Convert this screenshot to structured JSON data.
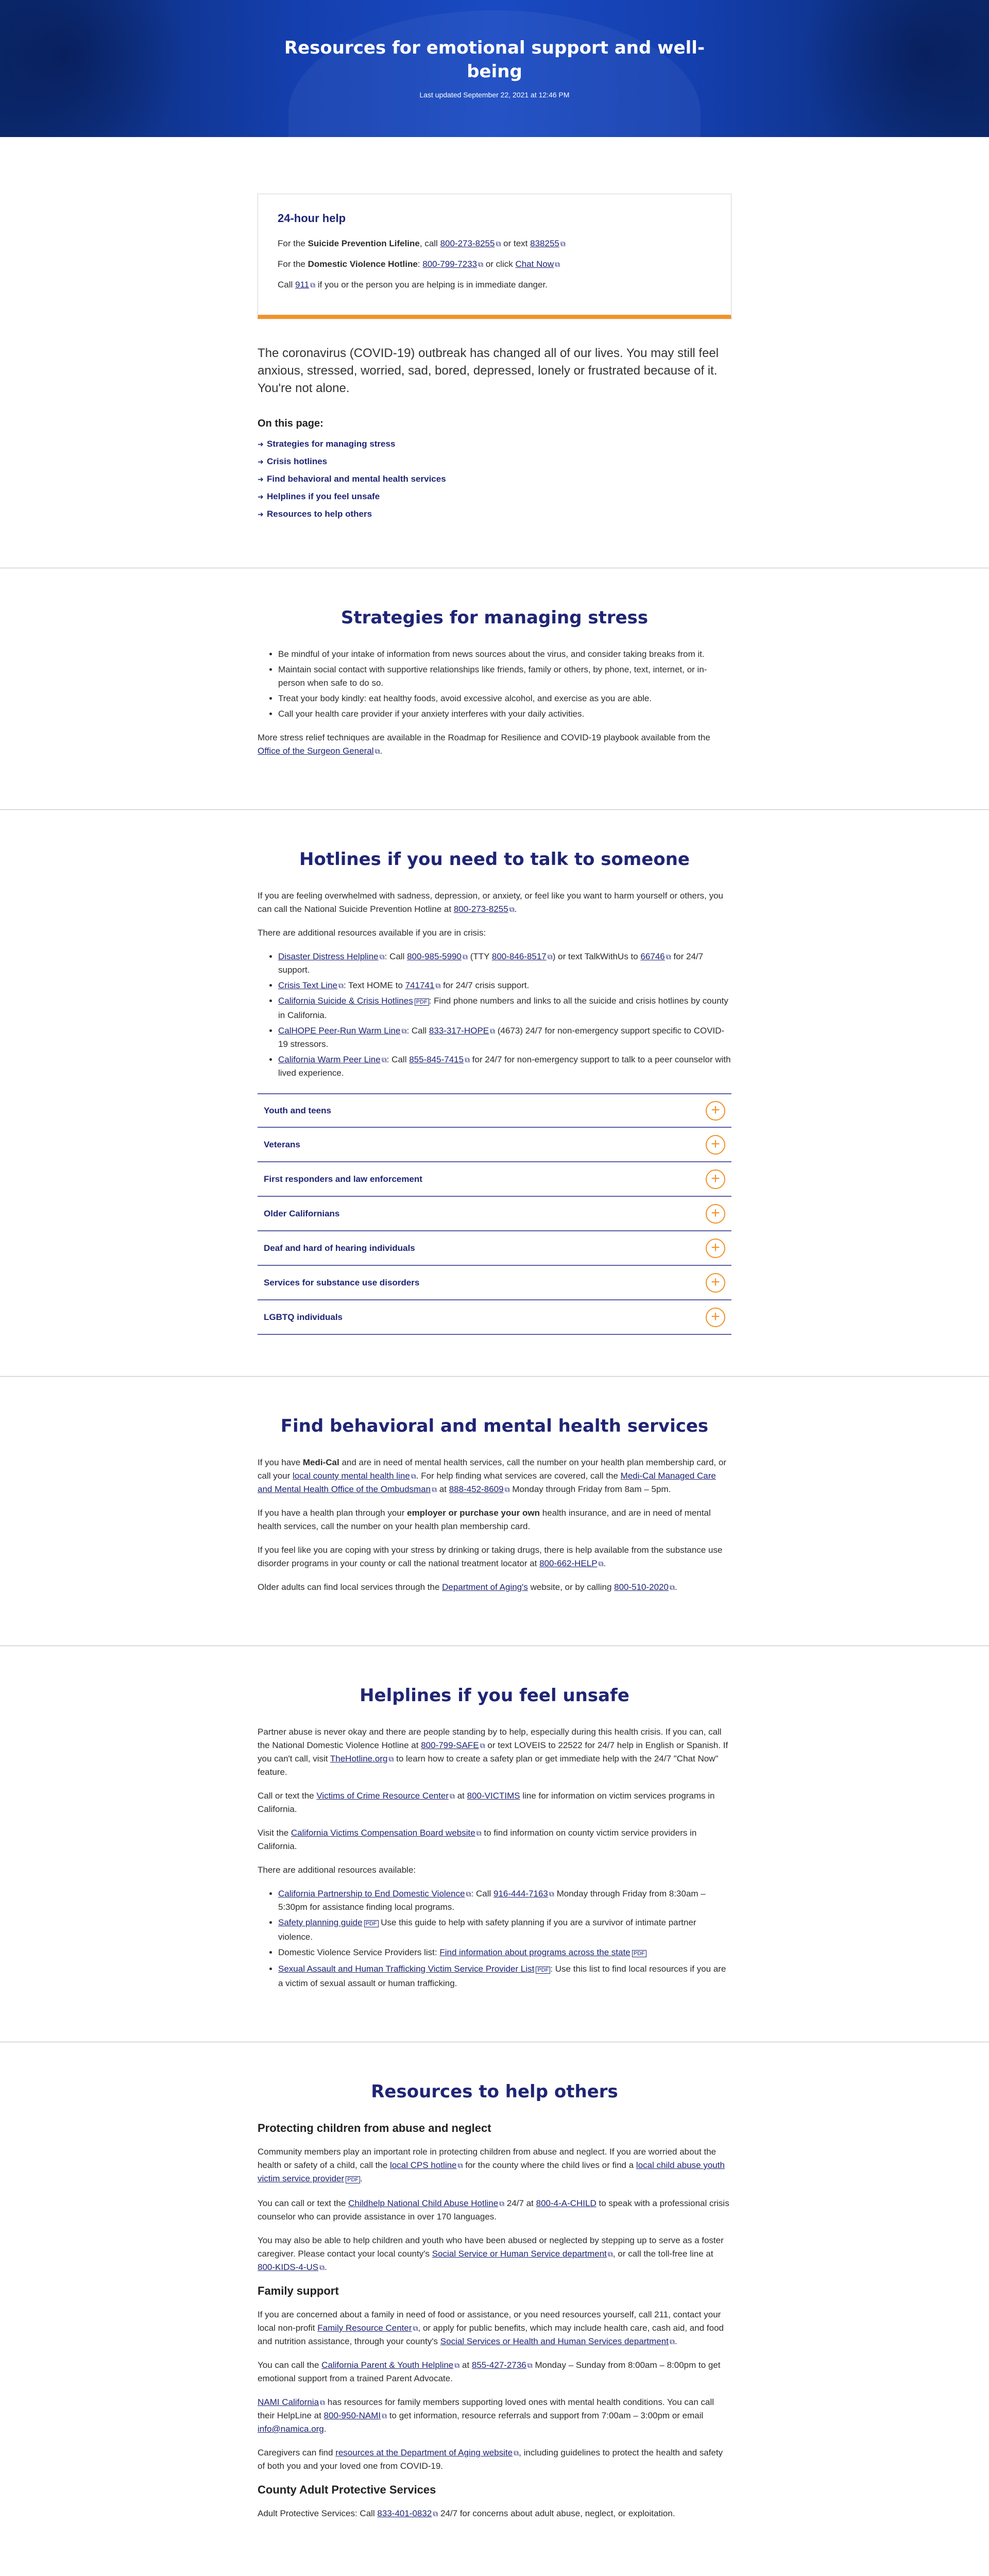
{
  "hero": {
    "title": "Resources for emotional support and well-being",
    "updated": "Last updated September 22, 2021 at 12:46 PM"
  },
  "help": {
    "title": "24-hour help",
    "line1_pre": "For the ",
    "line1_bold": "Suicide Prevention Lifeline",
    "line1_mid": ", call ",
    "line1_phone": "800-273-8255",
    "line1_mid2": " or text ",
    "line1_text": "838255",
    "line2_pre": "For the ",
    "line2_bold": "Domestic Violence Hotline",
    "line2_mid": ": ",
    "line2_phone": "800-799-7233",
    "line2_mid2": " or click ",
    "line2_chat": "Chat Now",
    "line3_pre": "Call ",
    "line3_num": "911",
    "line3_post": " if you or the person you are helping is in immediate danger."
  },
  "intro": "The coronavirus (COVID-19) outbreak has changed all of our lives. You may still feel anxious, stressed, worried, sad, bored, depressed, lonely or frustrated because of it. You're not alone.",
  "onpage": {
    "title": "On this page:",
    "items": [
      "Strategies for managing stress",
      "Crisis hotlines",
      "Find behavioral and mental health services",
      "Helplines if you feel unsafe",
      "Resources to help others"
    ]
  },
  "stress": {
    "title": "Strategies for managing stress",
    "bullets": [
      "Be mindful of your intake of information from news sources about the virus, and consider taking breaks from it.",
      "Maintain social contact with supportive relationships like friends, family or others, by phone, text, internet, or in-person when safe to do so.",
      "Treat your body kindly: eat healthy foods, avoid excessive alcohol, and exercise as you are able.",
      "Call your health care provider if your anxiety interferes with your daily activities."
    ],
    "more_pre": "More stress relief techniques are available in the Roadmap for Resilience and COVID-19 playbook available from the ",
    "more_link": "Office of the Surgeon General",
    "more_post": "."
  },
  "hotlines": {
    "title": "Hotlines if you need to talk to someone",
    "p1_pre": "If you are feeling overwhelmed with sadness, depression, or anxiety, or feel like you want to harm yourself or others, you can call the National Suicide Prevention Hotline at ",
    "p1_link": "800-273-8255",
    "p1_post": ".",
    "p2": "There are additional resources available if you are in crisis:",
    "items": [
      {
        "link": "Disaster Distress Helpline",
        "rest_pre": ": Call ",
        "l2": "800-985-5990",
        "mid": " (TTY ",
        "l3": "800-846-8517",
        "mid2": ") or text TalkWithUs to ",
        "l4": "66746",
        "post": " for 24/7 support."
      },
      {
        "link": "Crisis Text Line",
        "rest_pre": ": Text HOME to ",
        "l2": "741741",
        "post": " for 24/7 crisis support."
      },
      {
        "link": "California Suicide & Crisis Hotlines",
        "post": ": Find phone numbers and links to all the suicide and crisis hotlines by county in California."
      },
      {
        "link": "CalHOPE Peer-Run Warm Line",
        "rest_pre": ": Call ",
        "l2": "833-317-HOPE",
        "post": " (4673) 24/7 for non-emergency support specific to COVID-19 stressors."
      },
      {
        "link": "California Warm Peer Line",
        "rest_pre": ": Call ",
        "l2": "855-845-7415",
        "post": " for 24/7 for non-emergency support to talk to a peer counselor with lived experience."
      }
    ],
    "accordion": [
      "Youth and teens",
      "Veterans",
      "First responders and law enforcement",
      "Older Californians",
      "Deaf and hard of hearing individuals",
      "Services for substance use disorders",
      "LGBTQ individuals"
    ]
  },
  "behavioral": {
    "title": "Find behavioral and mental health services",
    "p1_pre": "If you have ",
    "p1_bold": "Medi-Cal",
    "p1_mid": " and are in need of mental health services, call the number on your health plan membership card, or call your ",
    "p1_link": "local county mental health line",
    "p1_mid2": ". For help finding what services are covered, call the ",
    "p1_link2": "Medi-Cal Managed Care and Mental Health Office of the Ombudsman",
    "p1_mid3": " at ",
    "p1_link3": "888-452-8609",
    "p1_post": " Monday through Friday from 8am – 5pm.",
    "p2_pre": "If you have a health plan through your ",
    "p2_bold": "employer or purchase your own",
    "p2_post": " health insurance, and are in need of mental health services, call the number on your health plan membership card.",
    "p3_pre": "If you feel like you are coping with your stress by drinking or taking drugs, there is help available from the substance use disorder programs in your county or call the national treatment locator at ",
    "p3_link": "800-662-HELP",
    "p3_post": ".",
    "p4_pre": "Older adults can find local services through the ",
    "p4_link": "Department of Aging's",
    "p4_mid": " website, or by calling ",
    "p4_link2": "800-510-2020",
    "p4_post": "."
  },
  "unsafe": {
    "title": "Helplines if you feel unsafe",
    "p1_pre": "Partner abuse is never okay and there are people standing by to help, especially during this health crisis. If you can, call the National Domestic Violence Hotline at ",
    "p1_link": "800-799-SAFE",
    "p1_mid": " or text LOVEIS to 22522 for 24/7 help in English or Spanish. If you can't call, visit ",
    "p1_link2": "TheHotline.org",
    "p1_post": " to learn how to create a safety plan or get immediate help with the 24/7 \"Chat Now\" feature.",
    "p2_pre": "Call or text the ",
    "p2_link": "Victims of Crime Resource Center",
    "p2_mid": " at ",
    "p2_link2": "800-VICTIMS",
    "p2_post": " line for information on victim services programs in California.",
    "p3_pre": "Visit the ",
    "p3_link": "California Victims Compensation Board website",
    "p3_post": " to find information on county victim service providers in California.",
    "p4": "There are additional resources available:",
    "b1_link": "California Partnership to End Domestic Violence",
    "b1_mid": ": Call ",
    "b1_link2": "916-444-7163",
    "b1_post": " Monday through Friday from 8:30am – 5:30pm for assistance finding local programs.",
    "b2_link": "Safety planning guide",
    "b2_post": " Use this guide to help with safety planning if you are a survivor of intimate partner violence.",
    "b3_pre": "Domestic Violence Service Providers list: ",
    "b3_link": "Find information about programs across the state",
    "b4_link": "Sexual Assault and Human Trafficking Victim Service Provider List",
    "b4_post": ": Use this list to find local resources if you are a victim of sexual assault or human trafficking."
  },
  "others": {
    "title": "Resources to help others",
    "h_children": "Protecting children from abuse and neglect",
    "c1_pre": "Community members play an important role in protecting children from abuse and neglect. If you are worried about the health or safety of a child, call the ",
    "c1_link": "local CPS hotline",
    "c1_mid": " for the county where the child lives or find a ",
    "c1_link2": "local child abuse youth victim service provider",
    "c1_post": ".",
    "c2_pre": "You can call or text the ",
    "c2_link": "Childhelp National Child Abuse Hotline",
    "c2_mid": " 24/7 at ",
    "c2_link2": "800-4-A-CHILD",
    "c2_post": " to speak with a professional crisis counselor who can provide assistance in over 170 languages.",
    "c3_pre": "You may also be able to help children and youth who have been abused or neglected by stepping up to serve as a foster caregiver. Please contact your local county's ",
    "c3_link": "Social Service or Human Service department",
    "c3_mid": ", or call the toll-free line at ",
    "c3_link2": "800-KIDS-4-US",
    "c3_post": ".",
    "h_family": "Family support",
    "f1_pre": "If you are concerned about a family in need of food or assistance, or you need resources yourself, call 211, contact your local non-profit ",
    "f1_link": "Family Resource Center",
    "f1_mid": ", or apply for public benefits, which may include health care, cash aid, and food and nutrition assistance, through your county's ",
    "f1_link2": "Social Services or Health and Human Services department",
    "f1_post": ".",
    "f2_pre": "You can call the ",
    "f2_link": "California Parent & Youth Helpline",
    "f2_mid": " at ",
    "f2_link2": "855-427-2736",
    "f2_post": " Monday – Sunday from 8:00am – 8:00pm to get emotional support from a trained Parent Advocate.",
    "f3_link": "NAMI California",
    "f3_mid": " has resources for family members supporting loved ones with mental health conditions. You can call their HelpLine at ",
    "f3_link2": "800-950-NAMI",
    "f3_mid2": " to get information, resource referrals and support from 7:00am – 3:00pm or email ",
    "f3_link3": "info@namica.org",
    "f3_post": ".",
    "f4_pre": "Caregivers can find ",
    "f4_link": "resources at the Department of Aging website",
    "f4_post": ", including guidelines to protect the health and safety of both you and your loved one from COVID-19.",
    "h_aps": "County Adult Protective Services",
    "a1_pre": "Adult Protective Services: Call ",
    "a1_link": "833-401-0832",
    "a1_post": " 24/7 for concerns about adult abuse, neglect, or exploitation."
  }
}
